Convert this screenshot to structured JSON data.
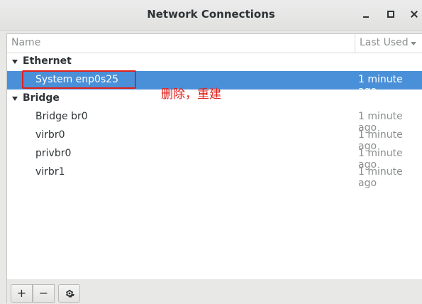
{
  "window": {
    "title": "Network Connections"
  },
  "columns": {
    "name": "Name",
    "last_used": "Last Used"
  },
  "groups": [
    {
      "label": "Ethernet",
      "items": [
        {
          "label": "System enp0s25",
          "last_used": "1 minute ago",
          "selected": true
        }
      ]
    },
    {
      "label": "Bridge",
      "items": [
        {
          "label": "Bridge br0",
          "last_used": "1 minute ago"
        },
        {
          "label": "virbr0",
          "last_used": "1 minute ago"
        },
        {
          "label": "privbr0",
          "last_used": "1 minute ago"
        },
        {
          "label": "virbr1",
          "last_used": "1 minute ago"
        }
      ]
    }
  ],
  "annotation": {
    "text": "删除，重建",
    "color": "#e0201b"
  },
  "toolbar": {
    "add_label": "+",
    "remove_label": "−",
    "settings_icon": "gear-icon"
  },
  "colors": {
    "selection": "#4a90d9",
    "annotation": "#e0201b"
  }
}
